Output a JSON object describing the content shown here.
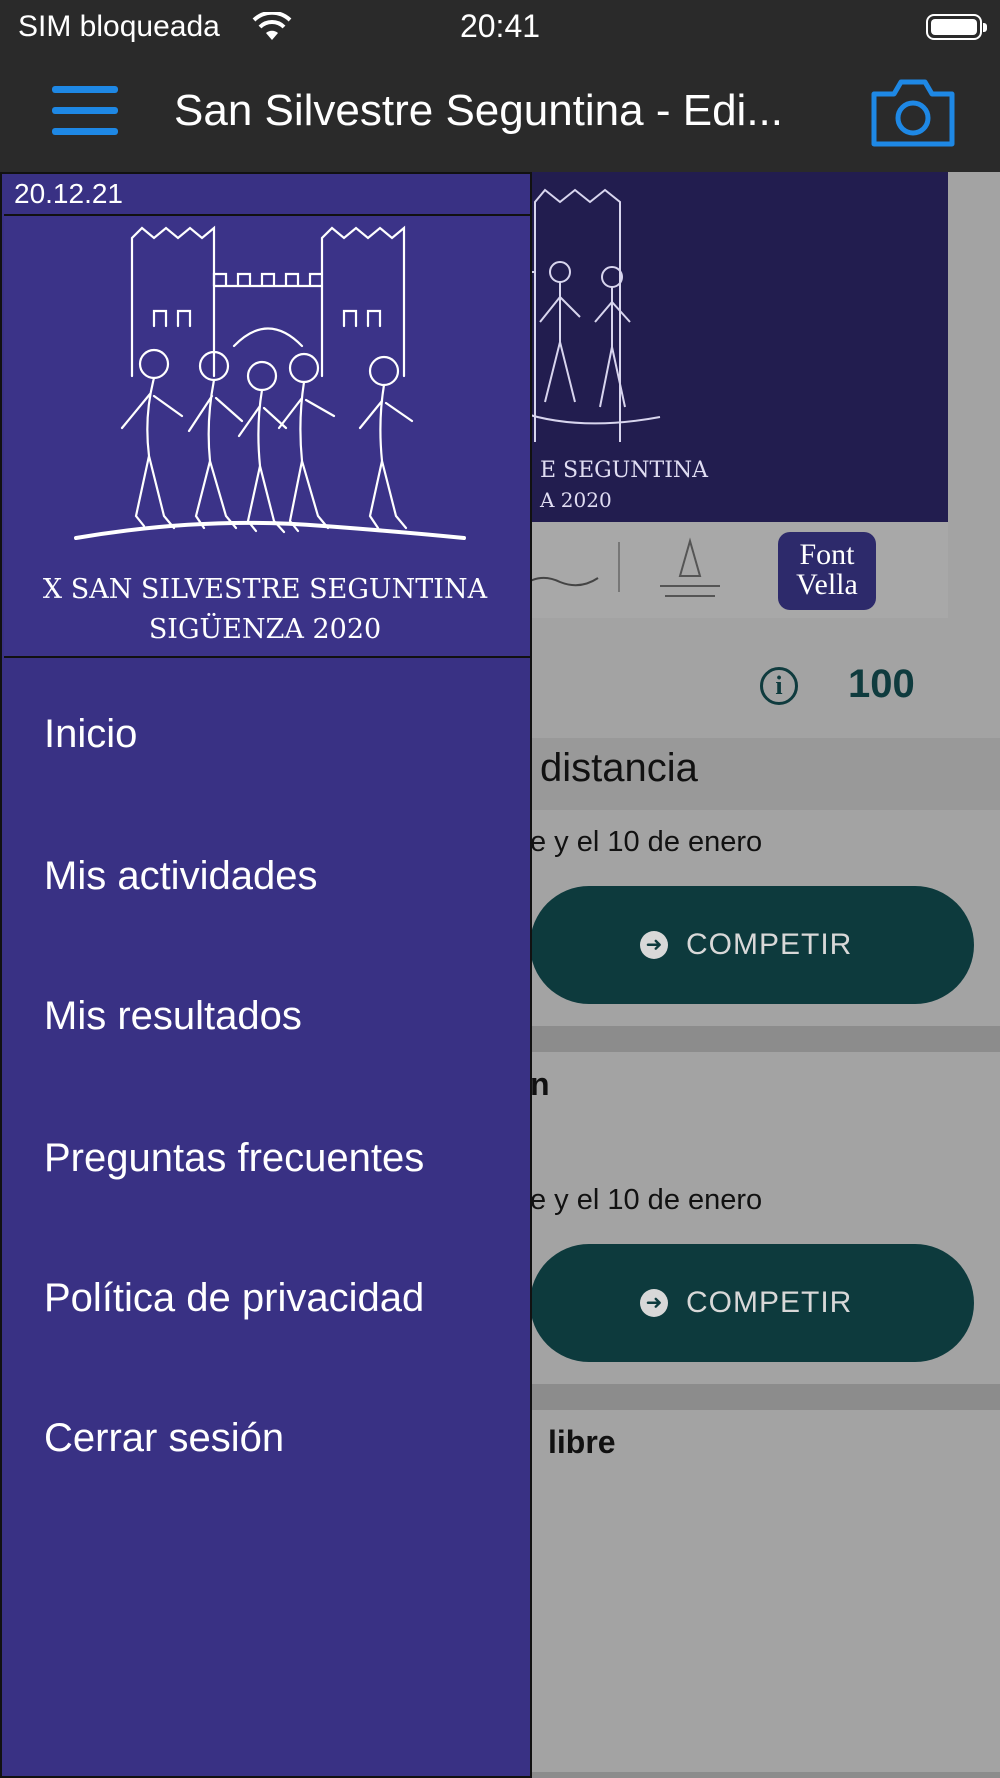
{
  "status_bar": {
    "carrier": "SIM bloqueada",
    "time": "20:41"
  },
  "nav": {
    "title": "San Silvestre Seguntina - Edi...",
    "menu_icon": "hamburger-menu-icon",
    "camera_icon": "camera-icon"
  },
  "banner": {
    "title_line1": "E SEGUNTINA",
    "title_line2": "A 2020",
    "sponsor": "Font Vella"
  },
  "background": {
    "points": "100",
    "section_title": "distancia",
    "card1_date": "e y el 10 de enero",
    "card1_button": "COMPETIR",
    "card2_title": "n",
    "card2_date": "e y el 10 de enero",
    "card2_button": "COMPETIR",
    "card3_title": "libre"
  },
  "drawer": {
    "date": "20.12.21",
    "logo_line1": "X SAN SILVESTRE SEGUNTINA",
    "logo_line2": "SIGÜENZA 2020",
    "items": [
      {
        "label": "Inicio"
      },
      {
        "label": "Mis actividades"
      },
      {
        "label": "Mis resultados"
      },
      {
        "label": "Preguntas frecuentes"
      },
      {
        "label": "Política de privacidad"
      },
      {
        "label": "Cerrar sesión"
      }
    ]
  },
  "colors": {
    "accent": "#1e88e5",
    "drawer_bg": "#393184",
    "button_bg": "#0d3a3d",
    "bar_bg": "#2a2a2a"
  }
}
